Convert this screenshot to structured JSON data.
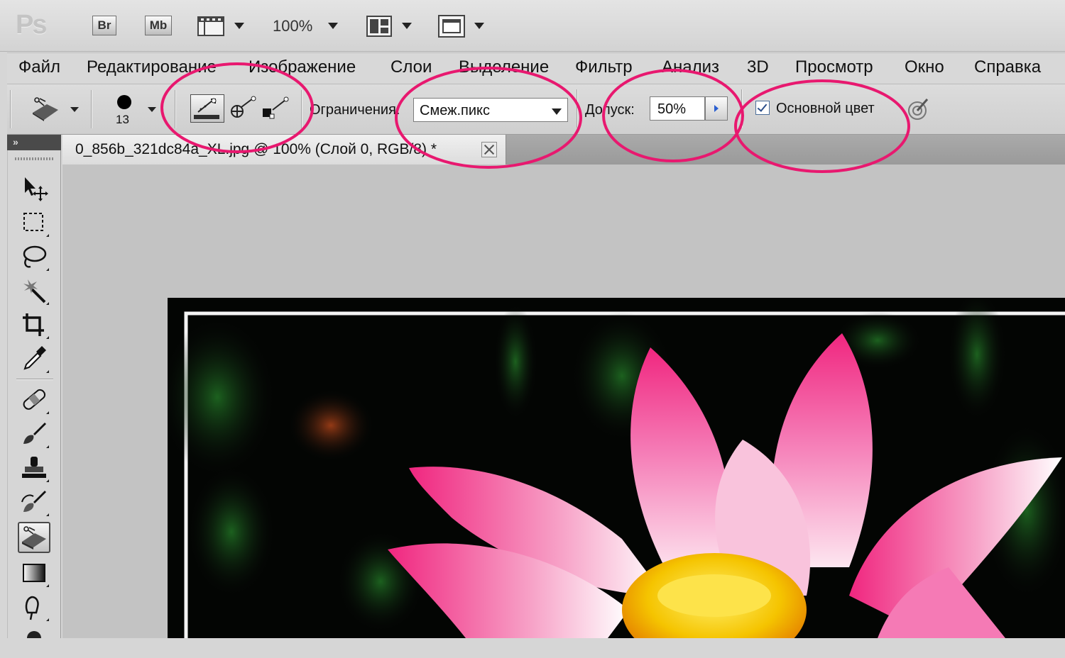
{
  "app": {
    "logo": "Ps",
    "bridge_label": "Br",
    "minibridge_label": "Mb",
    "zoom": "100%"
  },
  "menu": {
    "items": [
      "Файл",
      "Редактирование",
      "Изображение",
      "Слои",
      "Выделение",
      "Фильтр",
      "Анализ",
      "3D",
      "Просмотр",
      "Окно",
      "Справка"
    ]
  },
  "options": {
    "brush_size": "13",
    "limits_label": "Ограничения:",
    "limits_value": "Смеж.пикс",
    "tolerance_label": "Допуск:",
    "tolerance_value": "50%",
    "foreground_checkbox_label": "Основной цвет",
    "foreground_checked": true
  },
  "document": {
    "tab_title": "0_856b_321dc84a_XL.jpg @ 100% (Слой 0, RGB/8) *"
  },
  "toolbox": {
    "tools": [
      "move-tool",
      "marquee-tool",
      "lasso-tool",
      "magic-wand-tool",
      "crop-tool",
      "eyedropper-tool",
      "healing-brush-tool",
      "brush-tool",
      "clone-stamp-tool",
      "history-brush-tool",
      "background-eraser-tool",
      "gradient-tool",
      "blur-tool"
    ],
    "active_tool": "background-eraser-tool"
  },
  "colors": {
    "annotation": "#e8186f",
    "petal_pink": "#f0439a",
    "stamen_yellow": "#f5c400"
  }
}
